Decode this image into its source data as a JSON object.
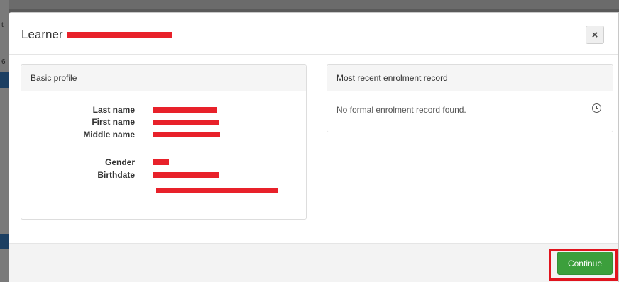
{
  "modal": {
    "title": "Learner",
    "close_label": "×"
  },
  "basic_profile": {
    "heading": "Basic profile",
    "fields": [
      {
        "label": "Last name"
      },
      {
        "label": "First name"
      },
      {
        "label": "Middle name"
      },
      {
        "label": "Gender"
      },
      {
        "label": "Birthdate"
      }
    ]
  },
  "enrolment": {
    "heading": "Most recent enrolment record",
    "message": "No formal enrolment record found.",
    "icon": "clock-icon"
  },
  "footer": {
    "continue_label": "Continue"
  },
  "colors": {
    "redaction": "#e8212a",
    "continue_button": "#3c9f3c",
    "highlight": "#e0141e"
  }
}
